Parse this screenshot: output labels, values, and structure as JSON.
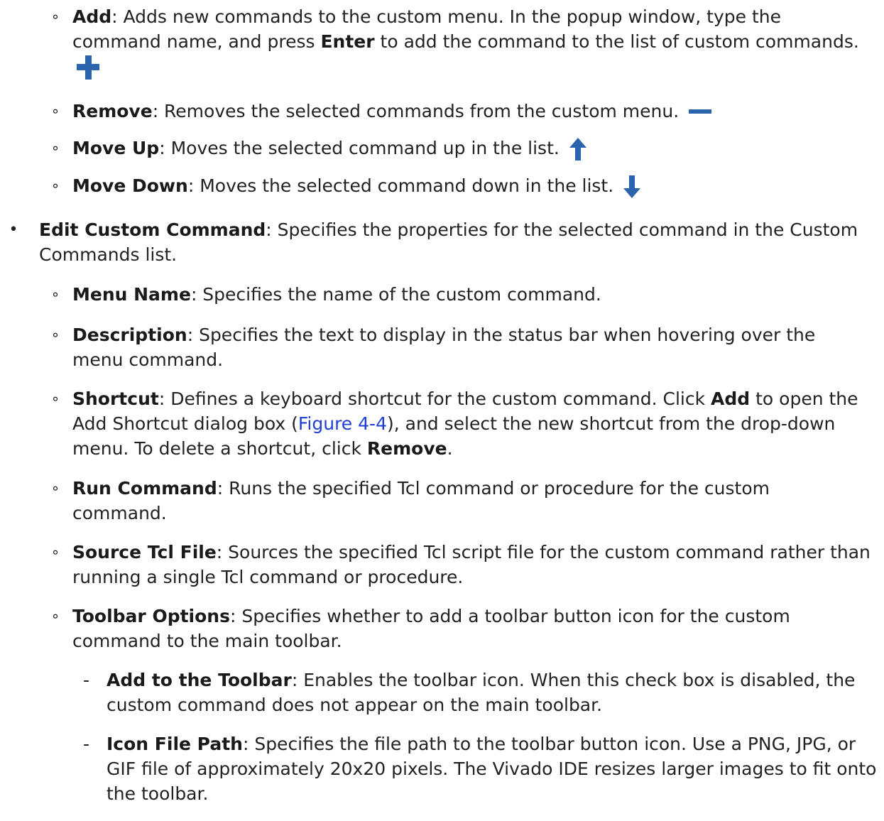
{
  "items": [
    {
      "id": "add",
      "term": "Add",
      "text": ": Adds new commands to the custom menu. In the popup window, type the command name, and press ",
      "bold2": "Enter",
      "text2": " to add the command to the list of custom commands.",
      "icon": "plus-icon"
    },
    {
      "id": "remove",
      "term": "Remove",
      "text": ": Removes the selected commands from the custom menu.",
      "icon": "minus-icon"
    },
    {
      "id": "moveup",
      "term": "Move Up",
      "text": ": Moves the selected command up in the list.",
      "icon": "arrow-up-icon"
    },
    {
      "id": "movedown",
      "term": "Move Down",
      "text": ": Moves the selected command down in the list.",
      "icon": "arrow-down-icon"
    },
    {
      "id": "edit",
      "term": "Edit Custom Command",
      "text": ": Specifies the properties for the selected command in the Custom Commands list."
    },
    {
      "id": "menuname",
      "term": "Menu Name",
      "text": ": Specifies the name of the custom command."
    },
    {
      "id": "description",
      "term": "Description",
      "text": ": Specifies the text to display in the status bar when hovering over the menu command."
    },
    {
      "id": "shortcut",
      "term": "Shortcut",
      "text": ": Defines a keyboard shortcut for the custom command. Click ",
      "bold2": "Add",
      "text2": " to open the Add Shortcut dialog box (",
      "link": "Figure 4-4",
      "text3": "), and select the new shortcut from the drop-down menu. To delete a shortcut, click ",
      "bold3": "Remove",
      "text4": "."
    },
    {
      "id": "runcommand",
      "term": "Run Command",
      "text": ": Runs the specified Tcl command or procedure for the custom command."
    },
    {
      "id": "sourcetcl",
      "term": "Source Tcl File",
      "text": ": Sources the specified Tcl script file for the custom command rather than running a single Tcl command or procedure."
    },
    {
      "id": "toolbaropts",
      "term": "Toolbar Options",
      "text": ": Specifies whether to add a toolbar button icon for the custom command to the main toolbar."
    },
    {
      "id": "addtoolbar",
      "term": "Add to the Toolbar",
      "text": ": Enables the toolbar icon. When this check box is disabled, the custom command does not appear on the main toolbar."
    },
    {
      "id": "iconpath",
      "term": "Icon File Path",
      "text": ": Specifies the file path to the toolbar button icon. Use a PNG, JPG, or GIF file of approximately 20x20 pixels. The Vivado IDE resizes larger images to fit onto the toolbar."
    }
  ],
  "markers": {
    "sub": "∘",
    "main": "•",
    "dash": "-"
  },
  "colors": {
    "icon_blue": "#2b63ad",
    "link": "#1f3fd6"
  }
}
